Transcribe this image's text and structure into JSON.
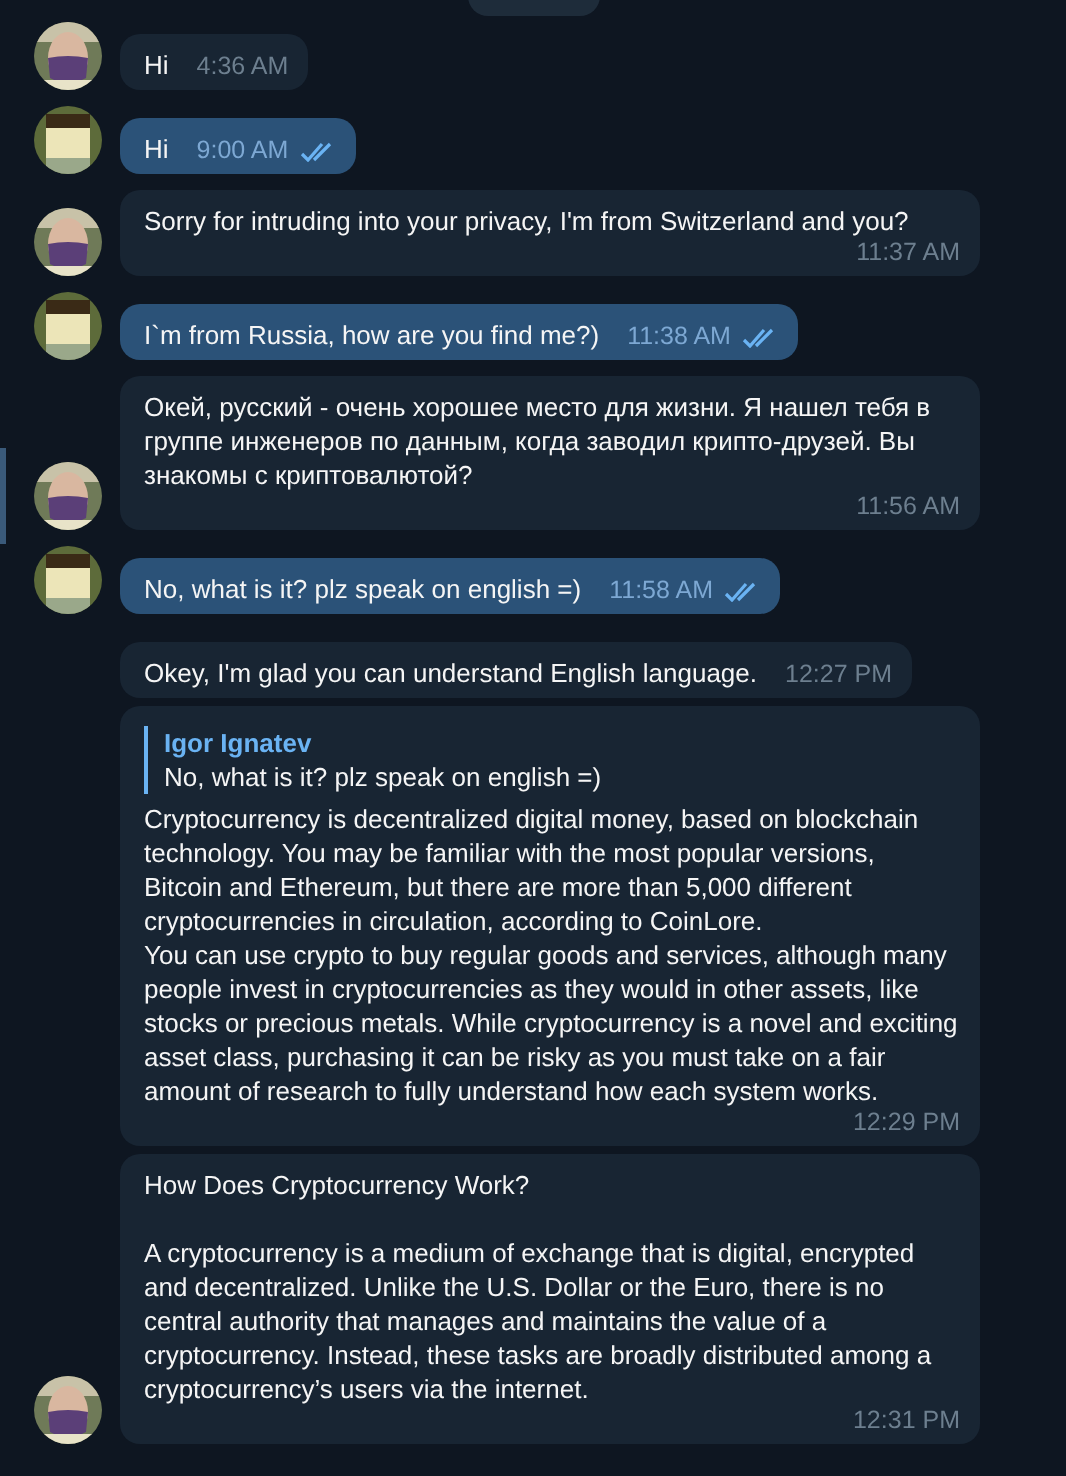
{
  "messages": [
    {
      "kind": "incoming",
      "avatar": true,
      "text": "Hi",
      "time": "4:36 AM"
    },
    {
      "kind": "outgoing",
      "avatar": true,
      "text": "Hi",
      "time": "9:00 AM",
      "read": true
    },
    {
      "kind": "incoming",
      "avatar": true,
      "text": "Sorry for intruding into your privacy, I'm from Switzerland and you?",
      "time": "11:37 AM"
    },
    {
      "kind": "outgoing",
      "avatar": true,
      "text": "I`m from Russia, how are you find me?)",
      "time": "11:38 AM",
      "read": true
    },
    {
      "kind": "incoming",
      "avatar": true,
      "text": "Окей, русский - очень хорошее место для жизни. Я нашел тебя в группе инженеров по данным, когда заводил крипто-друзей. Вы знакомы с криптовалютой?",
      "time": "11:56 AM"
    },
    {
      "kind": "outgoing",
      "avatar": true,
      "text": "No, what is it? plz speak on english =)",
      "time": "11:58 AM",
      "read": true
    },
    {
      "kind": "incoming",
      "avatar": false,
      "text": "Okey, I'm glad you can understand English language.",
      "time": "12:27 PM"
    },
    {
      "kind": "incoming",
      "avatar": false,
      "reply": {
        "author": "Igor Ignatev",
        "text": "No, what is it? plz speak on english =)"
      },
      "text": "Cryptocurrency is decentralized digital money, based on blockchain technology. You may be familiar with the most popular versions, Bitcoin and Ethereum, but there are more than 5,000 different cryptocurrencies in circulation, according to CoinLore.\nYou can use crypto to buy regular goods and services, although many people invest in cryptocurrencies as they would in other assets, like stocks or precious metals. While cryptocurrency is a novel and exciting asset class, purchasing it can be risky as you must take on a fair amount of research to fully understand how each system works.",
      "time": "12:29 PM"
    },
    {
      "kind": "incoming",
      "avatar": true,
      "text": "How Does Cryptocurrency Work?\n\nA cryptocurrency is a medium of exchange that is digital, encrypted and decentralized. Unlike the U.S. Dollar or the Euro, there is no central authority that manages and maintains the value of a cryptocurrency. Instead, these tasks are broadly distributed among a cryptocurrency’s users via the internet.",
      "time": "12:31 PM"
    }
  ]
}
